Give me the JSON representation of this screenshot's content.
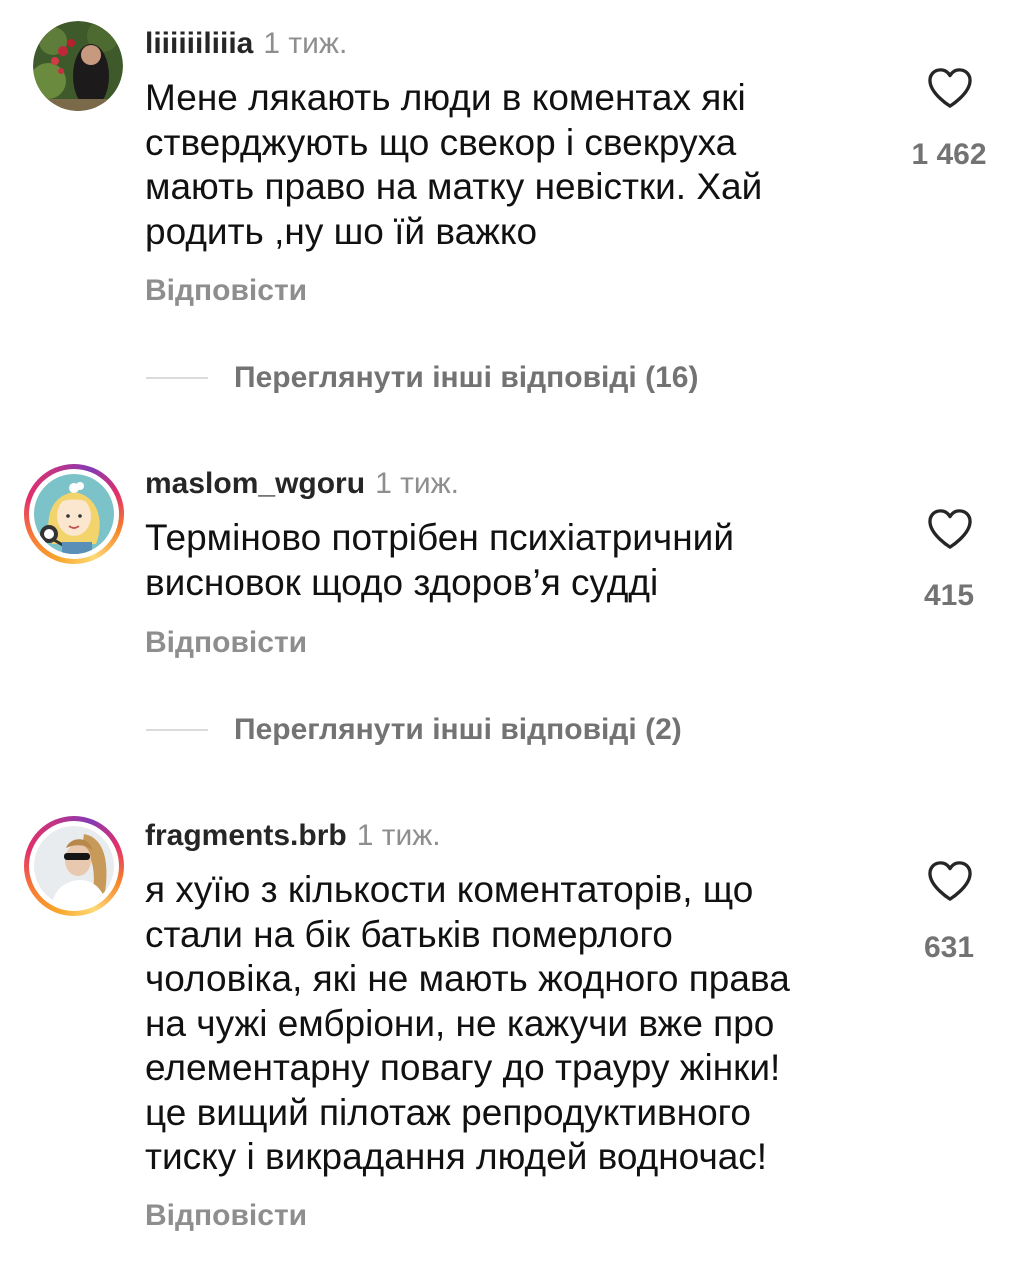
{
  "comments": [
    {
      "username": "liiiiiiliiia",
      "time": "1 тиж.",
      "lines": [
        "Мене лякають люди в коментах які",
        "стверджують що свекор і свекруха",
        "мають право на матку невістки. Хай",
        "родить ,ну шо їй важко"
      ],
      "likes": "1 462",
      "reply_label": "Відповісти",
      "view_replies": "Переглянути інші відповіді (16)"
    },
    {
      "username": "maslom_wgoru",
      "time": "1 тиж.",
      "lines": [
        "Терміново потрібен психіатричний",
        "висновок щодо здоров’я судді"
      ],
      "likes": "415",
      "reply_label": "Відповісти",
      "view_replies": "Переглянути інші відповіді (2)"
    },
    {
      "username": "fragments.brb",
      "time": "1 тиж.",
      "lines": [
        "я хуїю з кількости коментаторів, що",
        "стали на бік батьків померлого",
        "чоловіка, які не мають жодного права",
        "на чужі ембріони, не кажучи вже про",
        "елементарну повагу до трауру жінки!",
        "це вищий пілотаж репродуктивного",
        "тиску і викрадання людей водночас!"
      ],
      "likes": "631",
      "reply_label": "Відповісти"
    }
  ],
  "icons": {
    "like": "heart-outline-icon"
  },
  "colors": {
    "text": "#111111",
    "muted": "#8e8e8e",
    "story_ring": "#e1306c"
  }
}
